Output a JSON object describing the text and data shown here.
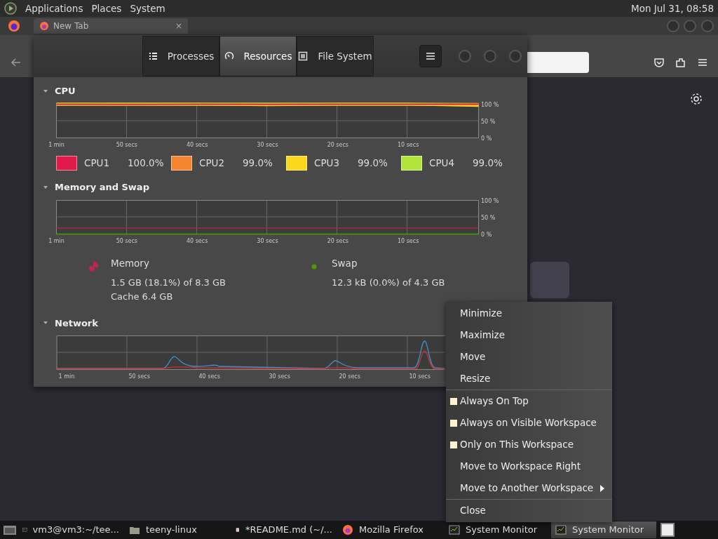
{
  "top_panel": {
    "menus": [
      "Applications",
      "Places",
      "System"
    ],
    "clock": "Mon Jul 31, 08:58"
  },
  "browser": {
    "tab": {
      "title": "New Tab",
      "close": "×"
    }
  },
  "system_monitor": {
    "tabs": [
      {
        "label": "Processes",
        "kind": "processes",
        "selected": false
      },
      {
        "label": "Resources",
        "kind": "resources",
        "selected": true
      },
      {
        "label": "File System",
        "kind": "files",
        "selected": false
      }
    ],
    "sections": [
      {
        "kind": "cpu",
        "title": "CPU",
        "chart_data": {
          "type": "line",
          "grid": true,
          "categories": [
            "1 min",
            "50 secs",
            "40 secs",
            "30 secs",
            "20 secs",
            "10 secs",
            null
          ],
          "ylim": [
            0,
            100
          ],
          "yticks": [
            {
              "value": 100,
              "label": "100 %"
            },
            {
              "value": 50,
              "label": "50 %"
            },
            {
              "value": 0,
              "label": "0 %"
            }
          ],
          "series": [
            {
              "name": "CPU1",
              "color": "#e0194b",
              "values": [
                100,
                100,
                100,
                100,
                100,
                100,
                100
              ]
            },
            {
              "name": "CPU2",
              "color": "#f5832f",
              "values": [
                100,
                99,
                100,
                99,
                100,
                100,
                100
              ]
            },
            {
              "name": "CPU3",
              "color": "#f9d71c",
              "values": [
                100,
                100,
                100,
                98,
                100,
                100,
                96
              ]
            },
            {
              "name": "CPU4",
              "color": "#b3e43a",
              "values": [
                100,
                100,
                100,
                100,
                100,
                100,
                99
              ]
            }
          ]
        },
        "legend": [
          {
            "value": "100.0%"
          },
          {
            "value": "99.0%"
          },
          {
            "value": "99.0%"
          },
          {
            "value": "99.0%"
          }
        ]
      },
      {
        "kind": "memory",
        "title": "Memory and Swap",
        "chart_data": {
          "type": "line",
          "grid": true,
          "categories": [
            "1 min",
            "50 secs",
            "40 secs",
            "30 secs",
            "20 secs",
            "10 secs",
            null
          ],
          "ylim": [
            0,
            100
          ],
          "yticks": [
            {
              "value": 100,
              "label": "100 %"
            },
            {
              "value": 50,
              "label": "50 %"
            },
            {
              "value": 0,
              "label": "0 %"
            }
          ],
          "series": [
            {
              "name": "Memory",
              "color": "#c4224f",
              "values": [
                18,
                18,
                18,
                18,
                18,
                18,
                18
              ]
            },
            {
              "name": "Swap",
              "color": "#4e9a06",
              "values": [
                0,
                0,
                0,
                0,
                0,
                0,
                0
              ]
            }
          ]
        },
        "meters": [
          {
            "lines": [
              "1.5 GB (18.1%) of 8.3 GB",
              "Cache 6.4 GB"
            ]
          },
          {
            "lines": [
              "12.3 kB (0.0%) of 4.3 GB"
            ]
          }
        ]
      },
      {
        "kind": "network",
        "title": "Network",
        "time_labels": [
          "1 min",
          "50 secs",
          "40 secs",
          "30 secs",
          "20 secs",
          "10 secs"
        ]
      }
    ]
  },
  "context_menu": {
    "groups": [
      [
        {
          "label": "Minimize",
          "kind": "plain"
        },
        {
          "label": "Maximize",
          "kind": "plain"
        },
        {
          "label": "Move",
          "kind": "plain"
        },
        {
          "label": "Resize",
          "kind": "plain"
        }
      ],
      [
        {
          "label": "Always On Top",
          "kind": "check",
          "checked": false
        },
        {
          "label": "Always on Visible Workspace",
          "kind": "radio",
          "selected": false
        },
        {
          "label": "Only on This Workspace",
          "kind": "radio",
          "selected": true
        },
        {
          "label": "Move to Workspace Right",
          "kind": "plain"
        },
        {
          "label": "Move to Another Workspace",
          "kind": "submenu"
        }
      ],
      [
        {
          "label": "Close",
          "kind": "plain"
        }
      ]
    ]
  },
  "taskbar": {
    "tasks": [
      {
        "label": "vm3@vm3:~/tee...",
        "kind": "terminal",
        "selected": false
      },
      {
        "label": "teeny-linux",
        "kind": "folder",
        "selected": false
      },
      {
        "label": "*README.md (~/...",
        "kind": "editor",
        "selected": false
      },
      {
        "label": "Mozilla Firefox",
        "kind": "browser",
        "selected": false
      },
      {
        "label": "System Monitor",
        "kind": "monitor",
        "selected": false
      },
      {
        "label": "System Monitor",
        "kind": "monitor",
        "selected": true
      }
    ]
  }
}
